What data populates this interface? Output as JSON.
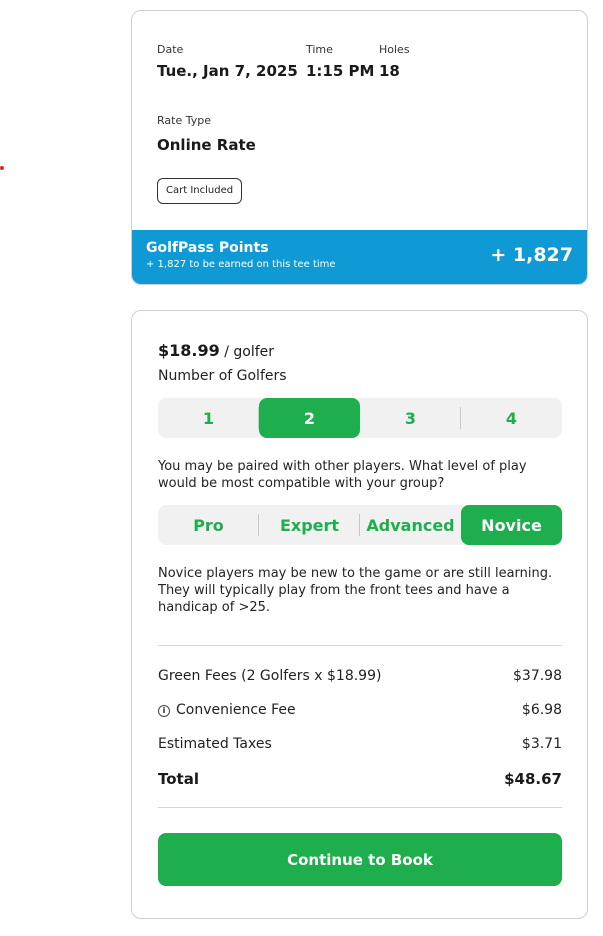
{
  "tee_time": {
    "date_label": "Date",
    "date_value": "Tue., Jan 7, 2025",
    "time_label": "Time",
    "time_value": "1:15 PM",
    "holes_label": "Holes",
    "holes_value": "18",
    "rate_type_label": "Rate Type",
    "rate_type_value": "Online Rate",
    "badge": "Cart Included"
  },
  "points": {
    "title": "GolfPass Points",
    "subtitle": "+ 1,827 to be earned on this tee time",
    "value": "+ 1,827",
    "color": "#0f9ad6"
  },
  "booking": {
    "price": "$18.99",
    "price_unit": "/ golfer",
    "golfers_label": "Number of Golfers",
    "golfer_options": [
      "1",
      "2",
      "3",
      "4"
    ],
    "golfers_selected": "2",
    "pairing_text": "You may be paired with other players. What level of play would be most compatible with your group?",
    "level_options": [
      "Pro",
      "Expert",
      "Advanced",
      "Novice"
    ],
    "level_selected": "Novice",
    "level_description": "Novice players may be new to the game or are still learning. They will typically play from the front tees and have a handicap of >25.",
    "fees": [
      {
        "label": "Green Fees (2 Golfers x $18.99)",
        "amount": "$37.98"
      },
      {
        "label": "Convenience Fee",
        "amount": "$6.98"
      },
      {
        "label": "Estimated Taxes",
        "amount": "$3.71"
      }
    ],
    "total_label": "Total",
    "total_amount": "$48.67",
    "cta": "Continue to Book",
    "accent_color": "#1eae4e"
  },
  "icons": {
    "info": "info-icon",
    "info_glyph": "i"
  }
}
